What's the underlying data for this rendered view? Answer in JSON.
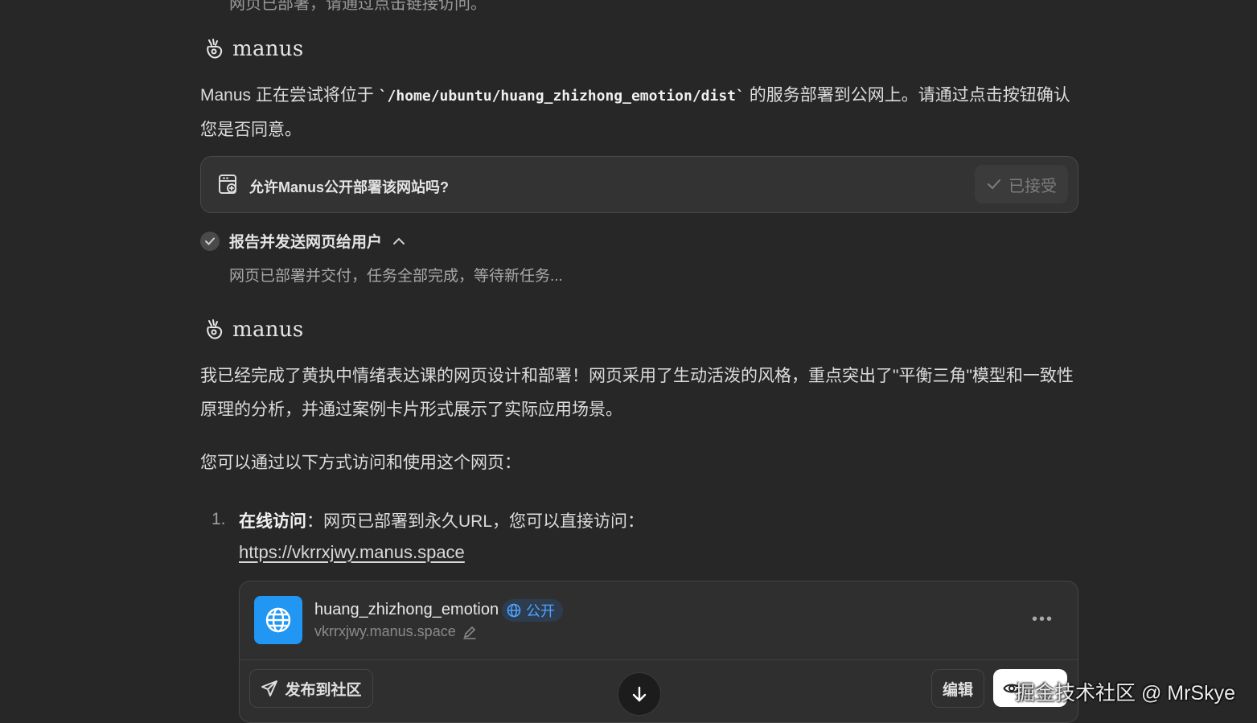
{
  "top_clipped_text": "网页已部署，请通过点击链接访问。",
  "brand": {
    "name": "manus"
  },
  "message1": {
    "text_before": "Manus 正在尝试将位于 ",
    "path": "`/home/ubuntu/huang_zhizhong_emotion/dist`",
    "text_after": " 的服务部署到公网上。请通过点击按钮确认您是否同意。"
  },
  "confirm": {
    "question": "允许Manus公开部署该网站吗?",
    "status": "已接受"
  },
  "step": {
    "title": "报告并发送网页给用户",
    "desc": "网页已部署并交付，任务全部完成，等待新任务..."
  },
  "message2": {
    "para1": "我已经完成了黄执中情绪表达课的网页设计和部署！网页采用了生动活泼的风格，重点突出了\"平衡三角\"模型和一致性原理的分析，并通过案例卡片形式展示了实际应用场景。",
    "para2": "您可以通过以下方式访问和使用这个网页：",
    "list": [
      {
        "num": "1.",
        "bold": "在线访问",
        "text": "：网页已部署到永久URL，您可以直接访问：",
        "link": "https://vkrrxjwy.manus.space"
      }
    ]
  },
  "site_card": {
    "name": "huang_zhizhong_emotion",
    "visibility": "公开",
    "domain": "vkrrxjwy.manus.space",
    "publish_label": "发布到社区",
    "edit_label": "编辑"
  },
  "watermark": "掘金技术社区 @ MrSkye"
}
